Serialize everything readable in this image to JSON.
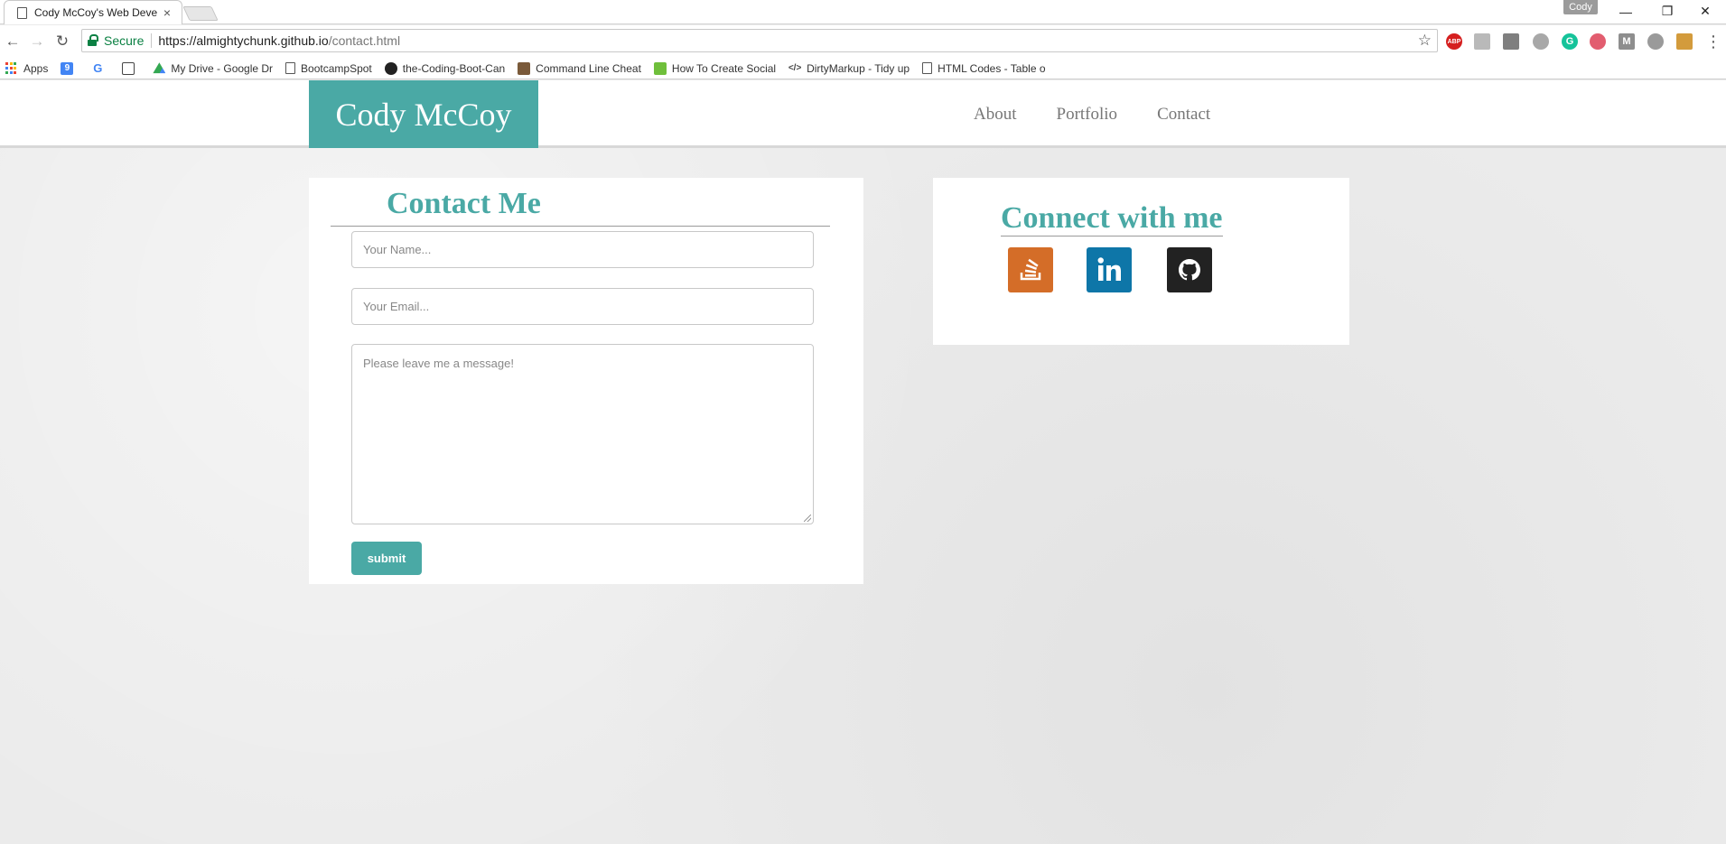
{
  "browser": {
    "tab_title": "Cody McCoy's Web Deve",
    "tab_close_glyph": "×",
    "profile_name": "Cody",
    "window_controls": {
      "minimize": "—",
      "restore": "❐",
      "close": "✕"
    },
    "secure_label": "Secure",
    "url_host": "https://almightychunk.github.io",
    "url_path": "/contact.html",
    "bookmarks": [
      {
        "label": "Apps"
      },
      {
        "label": ""
      },
      {
        "label": ""
      },
      {
        "label": ""
      },
      {
        "label": "My Drive - Google Dr"
      },
      {
        "label": "BootcampSpot"
      },
      {
        "label": "the-Coding-Boot-Can"
      },
      {
        "label": "Command Line Cheat"
      },
      {
        "label": "How To Create Social"
      },
      {
        "label": "DirtyMarkup - Tidy up"
      },
      {
        "label": "HTML Codes - Table o"
      }
    ],
    "extension_labels": {
      "abp": "ABP"
    }
  },
  "site": {
    "brand": "Cody McCoy",
    "nav": [
      {
        "label": "About"
      },
      {
        "label": "Portfolio"
      },
      {
        "label": "Contact"
      }
    ]
  },
  "contact": {
    "title": "Contact Me",
    "name_placeholder": "Your Name...",
    "email_placeholder": "Your Email...",
    "message_placeholder": "Please leave me a message!",
    "submit_label": "submit"
  },
  "connect": {
    "title": "Connect with me",
    "links": [
      {
        "icon": "stackoverflow-icon",
        "color": "#d46d28"
      },
      {
        "icon": "linkedin-icon",
        "color": "#0e76a8"
      },
      {
        "icon": "github-icon",
        "color": "#222222"
      }
    ]
  },
  "colors": {
    "brand": "#4aa9a5",
    "secure_green": "#0b8043"
  }
}
